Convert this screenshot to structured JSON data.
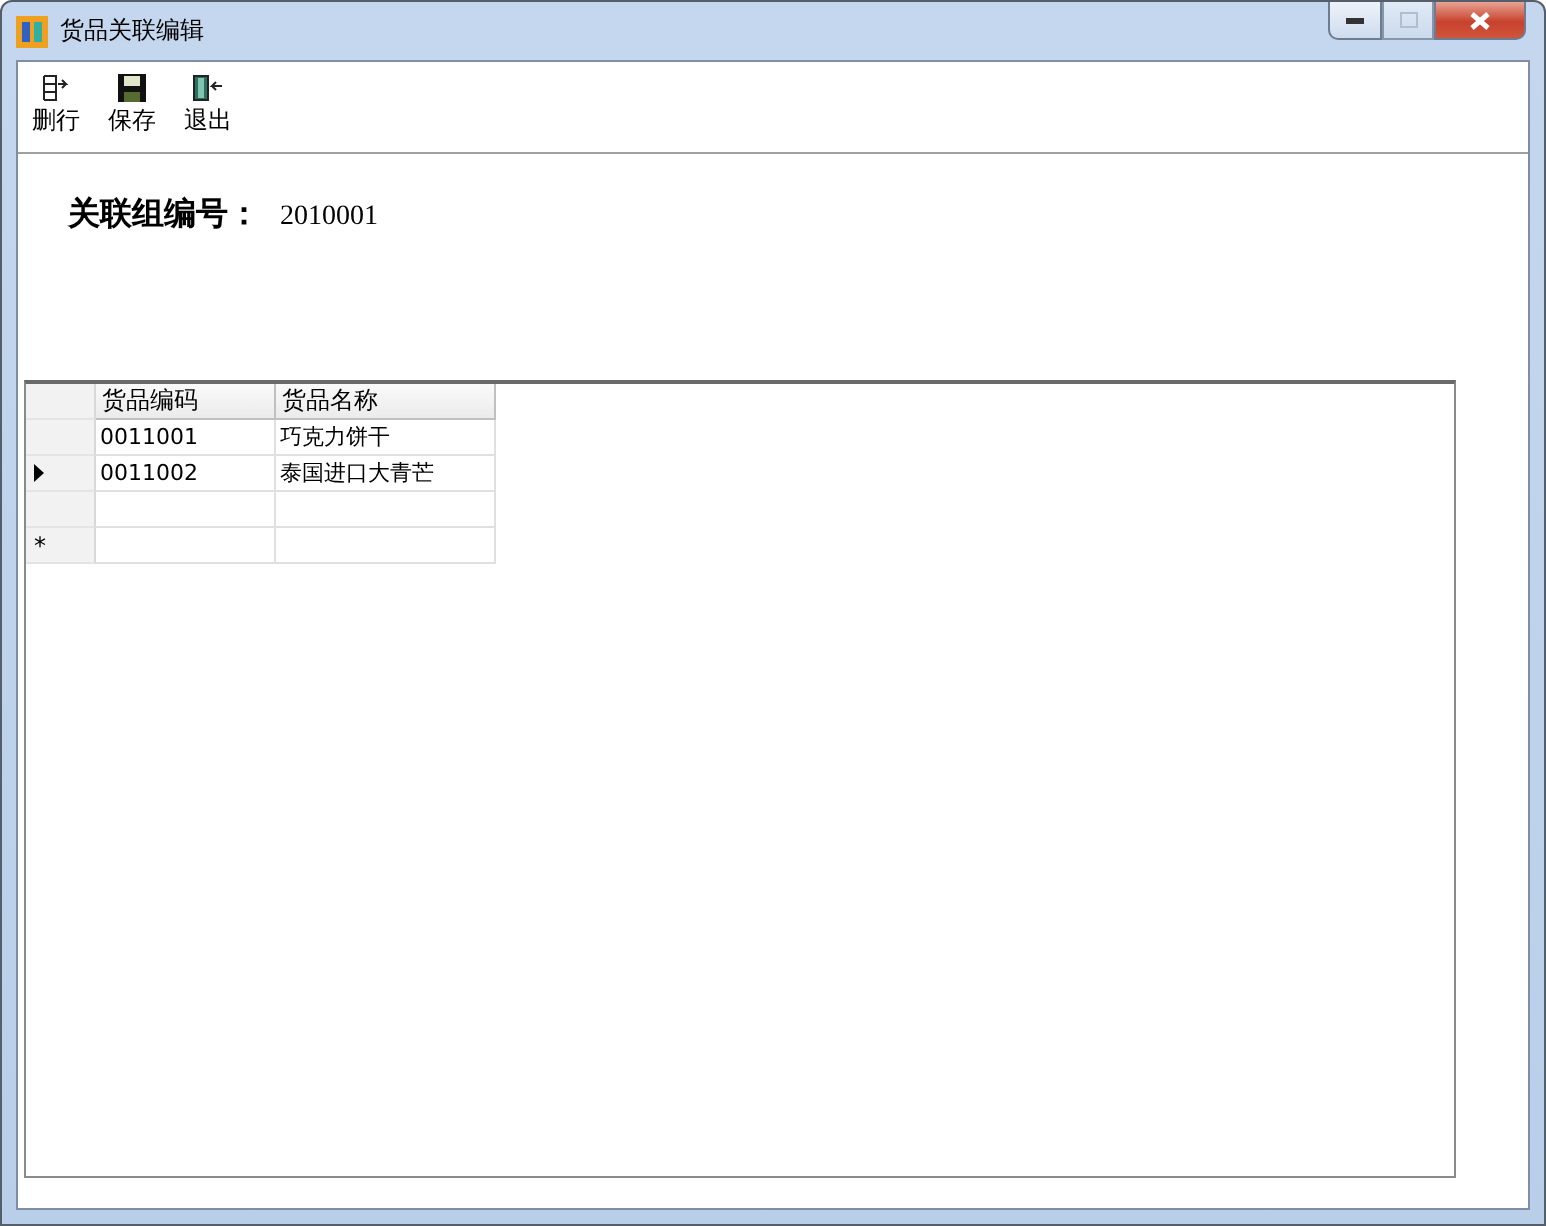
{
  "window": {
    "title": "货品关联编辑",
    "maximize_disabled": true
  },
  "toolbar": [
    {
      "label": "删行",
      "kind": "delete-row"
    },
    {
      "label": "保存",
      "kind": "save"
    },
    {
      "label": "退出",
      "kind": "exit"
    }
  ],
  "group": {
    "label": "关联组编号：",
    "value": "2010001"
  },
  "grid": {
    "columns": [
      "货品编码",
      "货品名称"
    ],
    "rows": [
      {
        "kind": "data",
        "current": false,
        "cells": [
          "0011001",
          "巧克力饼干"
        ]
      },
      {
        "kind": "data",
        "current": true,
        "cells": [
          "0011002",
          "泰国进口大青芒"
        ]
      },
      {
        "kind": "blank",
        "current": false,
        "cells": []
      },
      {
        "kind": "new",
        "current": false,
        "marker": "*",
        "cells": []
      }
    ]
  }
}
